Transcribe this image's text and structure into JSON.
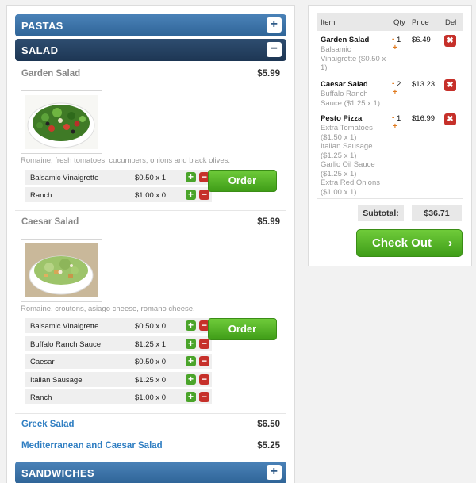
{
  "menu": {
    "categories": {
      "pastas": {
        "label": "PASTAS",
        "toggle": "+"
      },
      "salad": {
        "label": "SALAD",
        "toggle": "−"
      },
      "sandwiches": {
        "label": "SANDWICHES",
        "toggle": "+"
      }
    },
    "items": [
      {
        "name": "Garden Salad",
        "price": "$5.99",
        "image": "garden-salad-photo",
        "description": "Romaine, fresh tomatoes, cucumbers, onions and black olives.",
        "options": [
          {
            "name": "Balsamic Vinaigrette",
            "price": "$0.50 x 1"
          },
          {
            "name": "Ranch",
            "price": "$1.00 x 0"
          }
        ],
        "order_label": "Order"
      },
      {
        "name": "Caesar Salad",
        "price": "$5.99",
        "image": "caesar-salad-photo",
        "description": "Romaine, croutons, asiago cheese, romano cheese.",
        "options": [
          {
            "name": "Balsamic Vinaigrette",
            "price": "$0.50 x 0"
          },
          {
            "name": "Buffalo Ranch Sauce",
            "price": "$1.25 x 1"
          },
          {
            "name": "Caesar",
            "price": "$0.50 x 0"
          },
          {
            "name": "Italian Sausage",
            "price": "$1.25 x 0"
          },
          {
            "name": "Ranch",
            "price": "$1.00 x 0"
          }
        ],
        "order_label": "Order"
      },
      {
        "name": "Greek Salad",
        "price": "$6.50"
      },
      {
        "name": "Mediterranean and Caesar Salad",
        "price": "$5.25"
      }
    ],
    "option_plus": "+",
    "option_minus": "−"
  },
  "cart": {
    "headers": {
      "item": "Item",
      "qty": "Qty",
      "price": "Price",
      "del": "Del"
    },
    "rows": [
      {
        "name": "Garden Salad",
        "details": [
          "Balsamic",
          "Vinaigrette ($0.50 x",
          "1)"
        ],
        "qty": "1",
        "price": "$6.49"
      },
      {
        "name": "Caesar Salad",
        "details": [
          "Buffalo Ranch",
          "Sauce ($1.25 x 1)"
        ],
        "qty": "2",
        "price": "$13.23"
      },
      {
        "name": "Pesto Pizza",
        "details": [
          "Extra Tomatoes",
          "($1.50 x 1)",
          "Italian Sausage",
          "($1.25 x 1)",
          "Garlic Oil Sauce",
          "($1.25 x 1)",
          "Extra Red Onions",
          "($1.00 x 1)"
        ],
        "qty": "1",
        "price": "$16.99"
      }
    ],
    "qty_minus": "-",
    "qty_plus": "+",
    "delete_glyph": "✖",
    "subtotal_label": "Subtotal:",
    "subtotal_value": "$36.71",
    "checkout_label": "Check Out",
    "checkout_chevron": "›"
  },
  "colors": {
    "category_blue": "#2f6497",
    "category_active": "#1d3654",
    "order_green": "#4aa42a",
    "remove_red": "#c6302a",
    "qty_orange": "#e07a1f",
    "link_blue": "#2f7ec2"
  }
}
